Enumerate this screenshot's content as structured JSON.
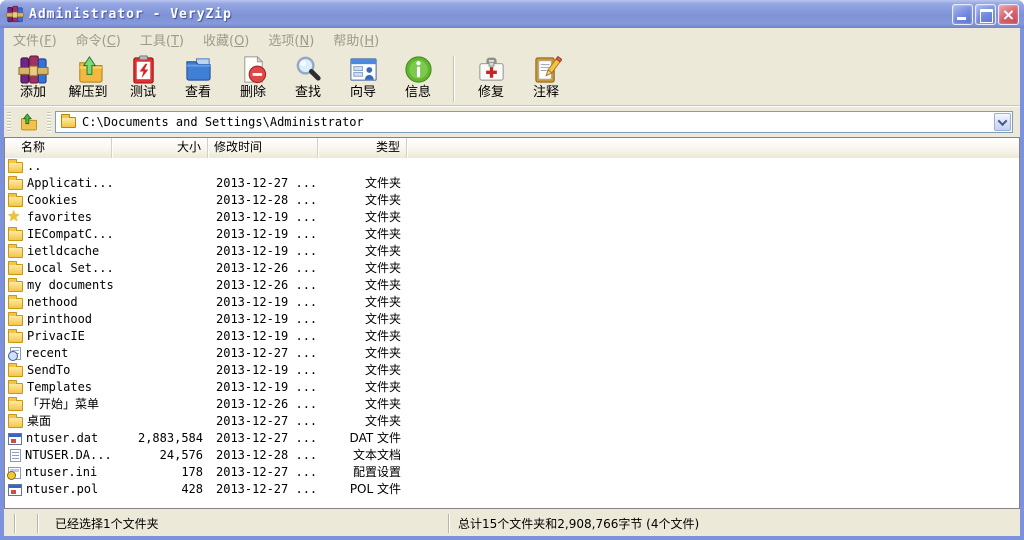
{
  "window": {
    "title": "Administrator - VeryZip",
    "controls": {
      "minimize": "minimize",
      "maximize": "maximize",
      "close": "close"
    }
  },
  "menu": {
    "items": [
      {
        "pre": "文件(",
        "key": "F",
        "post": ")"
      },
      {
        "pre": "命令(",
        "key": "C",
        "post": ")"
      },
      {
        "pre": "工具(",
        "key": "T",
        "post": ")"
      },
      {
        "pre": "收藏(",
        "key": "O",
        "post": ")"
      },
      {
        "pre": "选项(",
        "key": "N",
        "post": ")"
      },
      {
        "pre": "帮助(",
        "key": "H",
        "post": ")"
      }
    ]
  },
  "toolbar": {
    "items": [
      {
        "icon": "add-books",
        "label": "添加"
      },
      {
        "icon": "extract-folder",
        "label": "解压到"
      },
      {
        "icon": "test-clipboard",
        "label": "测试"
      },
      {
        "icon": "view-folder",
        "label": "查看"
      },
      {
        "icon": "delete-page",
        "label": "删除"
      },
      {
        "icon": "find-magnifier",
        "label": "查找"
      },
      {
        "icon": "wizard-window",
        "label": "向导"
      },
      {
        "icon": "info-circle",
        "label": "信息"
      },
      {
        "icon": "repair-case",
        "label": "修复"
      },
      {
        "icon": "comment-clipboard",
        "label": "注释"
      }
    ]
  },
  "addressbar": {
    "path": "C:\\Documents and Settings\\Administrator"
  },
  "filelist": {
    "columns": [
      {
        "label": "名称"
      },
      {
        "label": "大小"
      },
      {
        "label": "修改时间"
      },
      {
        "label": "类型"
      }
    ],
    "rows": [
      {
        "icon": "folder",
        "name": "..",
        "size": "",
        "date": "",
        "type": ""
      },
      {
        "icon": "folder",
        "name": "Applicati...",
        "size": "",
        "date": "2013-12-27 ...",
        "type": "文件夹"
      },
      {
        "icon": "folder",
        "name": "Cookies",
        "size": "",
        "date": "2013-12-28 ...",
        "type": "文件夹"
      },
      {
        "icon": "star",
        "name": "favorites",
        "size": "",
        "date": "2013-12-19 ...",
        "type": "文件夹"
      },
      {
        "icon": "folder",
        "name": "IECompatC...",
        "size": "",
        "date": "2013-12-19 ...",
        "type": "文件夹"
      },
      {
        "icon": "folder",
        "name": "ietldcache",
        "size": "",
        "date": "2013-12-19 ...",
        "type": "文件夹"
      },
      {
        "icon": "folder",
        "name": "Local Set...",
        "size": "",
        "date": "2013-12-26 ...",
        "type": "文件夹"
      },
      {
        "icon": "folder",
        "name": "my documents",
        "size": "",
        "date": "2013-12-26 ...",
        "type": "文件夹"
      },
      {
        "icon": "folder",
        "name": "nethood",
        "size": "",
        "date": "2013-12-19 ...",
        "type": "文件夹"
      },
      {
        "icon": "folder",
        "name": "printhood",
        "size": "",
        "date": "2013-12-19 ...",
        "type": "文件夹"
      },
      {
        "icon": "folder",
        "name": "PrivacIE",
        "size": "",
        "date": "2013-12-19 ...",
        "type": "文件夹"
      },
      {
        "icon": "recent",
        "name": "recent",
        "size": "",
        "date": "2013-12-27 ...",
        "type": "文件夹"
      },
      {
        "icon": "folder",
        "name": "SendTo",
        "size": "",
        "date": "2013-12-19 ...",
        "type": "文件夹"
      },
      {
        "icon": "folder",
        "name": "Templates",
        "size": "",
        "date": "2013-12-19 ...",
        "type": "文件夹"
      },
      {
        "icon": "folder",
        "name": "「开始」菜单",
        "size": "",
        "date": "2013-12-26 ...",
        "type": "文件夹"
      },
      {
        "icon": "folder",
        "name": "桌面",
        "size": "",
        "date": "2013-12-27 ...",
        "type": "文件夹"
      },
      {
        "icon": "sysfile",
        "name": "ntuser.dat",
        "size": "2,883,584",
        "date": "2013-12-27 ...",
        "type": "DAT 文件"
      },
      {
        "icon": "textdoc",
        "name": "NTUSER.DA...",
        "size": "24,576",
        "date": "2013-12-28 ...",
        "type": "文本文档"
      },
      {
        "icon": "inifile",
        "name": "ntuser.ini",
        "size": "178",
        "date": "2013-12-27 ...",
        "type": "配置设置"
      },
      {
        "icon": "sysfile",
        "name": "ntuser.pol",
        "size": "428",
        "date": "2013-12-27 ...",
        "type": "POL 文件"
      }
    ]
  },
  "statusbar": {
    "left": "已经选择1个文件夹",
    "right": "总计15个文件夹和2,908,766字节 (4个文件)"
  },
  "colors": {
    "titlebar": "#7e92d6",
    "border": "#7c92dc",
    "chrome": "#ece9d8",
    "selection_accent": "#0a246a"
  }
}
